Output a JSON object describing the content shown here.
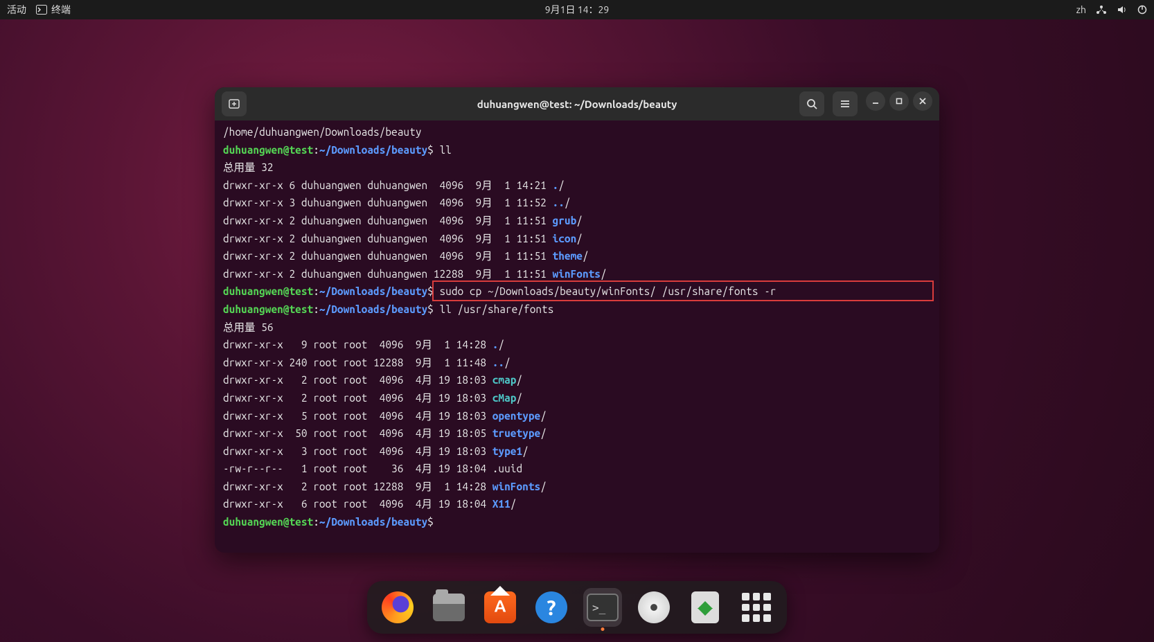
{
  "topbar": {
    "activities": "活动",
    "app_name": "终端",
    "datetime": "9月1日 14：29",
    "input_method": "zh"
  },
  "terminal": {
    "title": "duhuangwen@test: ~/Downloads/beauty",
    "lines": [
      [
        {
          "c": "plain",
          "t": "/home/duhuangwen/Downloads/beauty"
        }
      ],
      [
        {
          "c": "green",
          "t": "duhuangwen@test"
        },
        {
          "c": "plain",
          "t": ":"
        },
        {
          "c": "blue",
          "t": "~/Downloads/beauty"
        },
        {
          "c": "plain",
          "t": "$ ll"
        }
      ],
      [
        {
          "c": "plain",
          "t": "总用量 32"
        }
      ],
      [
        {
          "c": "plain",
          "t": "drwxr-xr-x 6 duhuangwen duhuangwen  4096  9月  1 14:21 "
        },
        {
          "c": "blue",
          "t": "."
        },
        {
          "c": "plain",
          "t": "/"
        }
      ],
      [
        {
          "c": "plain",
          "t": "drwxr-xr-x 3 duhuangwen duhuangwen  4096  9月  1 11:52 "
        },
        {
          "c": "blue",
          "t": ".."
        },
        {
          "c": "plain",
          "t": "/"
        }
      ],
      [
        {
          "c": "plain",
          "t": "drwxr-xr-x 2 duhuangwen duhuangwen  4096  9月  1 11:51 "
        },
        {
          "c": "blue",
          "t": "grub"
        },
        {
          "c": "plain",
          "t": "/"
        }
      ],
      [
        {
          "c": "plain",
          "t": "drwxr-xr-x 2 duhuangwen duhuangwen  4096  9月  1 11:51 "
        },
        {
          "c": "blue",
          "t": "icon"
        },
        {
          "c": "plain",
          "t": "/"
        }
      ],
      [
        {
          "c": "plain",
          "t": "drwxr-xr-x 2 duhuangwen duhuangwen  4096  9月  1 11:51 "
        },
        {
          "c": "blue",
          "t": "theme"
        },
        {
          "c": "plain",
          "t": "/"
        }
      ],
      [
        {
          "c": "plain",
          "t": "drwxr-xr-x 2 duhuangwen duhuangwen 12288  9月  1 11:51 "
        },
        {
          "c": "blue",
          "t": "winFonts"
        },
        {
          "c": "plain",
          "t": "/"
        }
      ],
      [
        {
          "c": "green",
          "t": "duhuangwen@test"
        },
        {
          "c": "plain",
          "t": ":"
        },
        {
          "c": "blue",
          "t": "~/Downloads/beauty"
        },
        {
          "c": "plain",
          "t": "$ sudo cp ~/Downloads/beauty/winFonts/ /usr/share/fonts -r"
        }
      ],
      [
        {
          "c": "green",
          "t": "duhuangwen@test"
        },
        {
          "c": "plain",
          "t": ":"
        },
        {
          "c": "blue",
          "t": "~/Downloads/beauty"
        },
        {
          "c": "plain",
          "t": "$ ll /usr/share/fonts"
        }
      ],
      [
        {
          "c": "plain",
          "t": "总用量 56"
        }
      ],
      [
        {
          "c": "plain",
          "t": "drwxr-xr-x   9 root root  4096  9月  1 14:28 "
        },
        {
          "c": "blue",
          "t": "."
        },
        {
          "c": "plain",
          "t": "/"
        }
      ],
      [
        {
          "c": "plain",
          "t": "drwxr-xr-x 240 root root 12288  9月  1 11:48 "
        },
        {
          "c": "blue",
          "t": ".."
        },
        {
          "c": "plain",
          "t": "/"
        }
      ],
      [
        {
          "c": "plain",
          "t": "drwxr-xr-x   2 root root  4096  4月 19 18:03 "
        },
        {
          "c": "cyan",
          "t": "cmap"
        },
        {
          "c": "plain",
          "t": "/"
        }
      ],
      [
        {
          "c": "plain",
          "t": "drwxr-xr-x   2 root root  4096  4月 19 18:03 "
        },
        {
          "c": "cyan",
          "t": "cMap"
        },
        {
          "c": "plain",
          "t": "/"
        }
      ],
      [
        {
          "c": "plain",
          "t": "drwxr-xr-x   5 root root  4096  4月 19 18:03 "
        },
        {
          "c": "blue",
          "t": "opentype"
        },
        {
          "c": "plain",
          "t": "/"
        }
      ],
      [
        {
          "c": "plain",
          "t": "drwxr-xr-x  50 root root  4096  4月 19 18:05 "
        },
        {
          "c": "blue",
          "t": "truetype"
        },
        {
          "c": "plain",
          "t": "/"
        }
      ],
      [
        {
          "c": "plain",
          "t": "drwxr-xr-x   3 root root  4096  4月 19 18:03 "
        },
        {
          "c": "blue",
          "t": "type1"
        },
        {
          "c": "plain",
          "t": "/"
        }
      ],
      [
        {
          "c": "plain",
          "t": "-rw-r--r--   1 root root    36  4月 19 18:04 .uuid"
        }
      ],
      [
        {
          "c": "plain",
          "t": "drwxr-xr-x   2 root root 12288  9月  1 14:28 "
        },
        {
          "c": "blue",
          "t": "winFonts"
        },
        {
          "c": "plain",
          "t": "/"
        }
      ],
      [
        {
          "c": "plain",
          "t": "drwxr-xr-x   6 root root  4096  4月 19 18:04 "
        },
        {
          "c": "blue",
          "t": "X11"
        },
        {
          "c": "plain",
          "t": "/"
        }
      ],
      [
        {
          "c": "green",
          "t": "duhuangwen@test"
        },
        {
          "c": "plain",
          "t": ":"
        },
        {
          "c": "blue",
          "t": "~/Downloads/beauty"
        },
        {
          "c": "plain",
          "t": "$ "
        }
      ]
    ],
    "highlight_line_index": 9
  },
  "help_glyph": "?",
  "terminal_prompt_glyph": ">_"
}
